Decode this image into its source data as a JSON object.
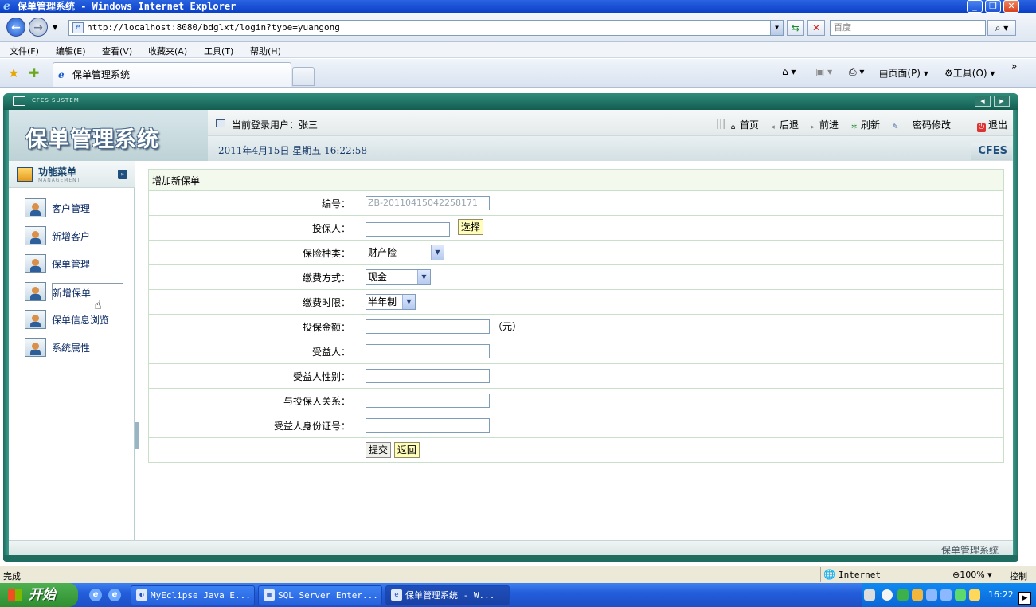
{
  "browser": {
    "window_title": "保单管理系统 - Windows Internet Explorer",
    "url": "http://localhost:8080/bdglxt/login?type=yuangong",
    "search_placeholder": "百度",
    "menu": [
      "文件(F)",
      "编辑(E)",
      "查看(V)",
      "收藏夹(A)",
      "工具(T)",
      "帮助(H)"
    ],
    "tab_label": "保单管理系统",
    "toolbar": {
      "page": "页面(P)",
      "tools": "工具(O)"
    },
    "status_text": "完成",
    "zone": "Internet",
    "zoom": "100%"
  },
  "app": {
    "frame_label": "CFES SUSTEM",
    "system_title": "保单管理系统",
    "current_user": "当前登录用户：张三",
    "datetime": "2011年4月15日  星期五  16:22:58",
    "brand": "CFES",
    "nav": {
      "home": "首页",
      "back": "后退",
      "forward": "前进",
      "refresh": "刷新",
      "change_password": "密码修改",
      "logout": "退出"
    },
    "sidebar": {
      "title": "功能菜单",
      "subtitle": "MANAGEMENT",
      "items": [
        "客户管理",
        "新增客户",
        "保单管理",
        "新增保单",
        "保单信息浏览",
        "系统属性"
      ],
      "active_index": 3
    },
    "form": {
      "caption": "增加新保单",
      "fields": {
        "number_label": "编号：",
        "number_value": "ZB-20110415042258171",
        "insured_label": "投保人：",
        "choose_btn": "选择",
        "type_label": "保险种类：",
        "type_value": "财产险",
        "payment_label": "缴费方式：",
        "payment_value": "现金",
        "period_label": "缴费时限：",
        "period_value": "半年制",
        "amount_label": "投保金额：",
        "amount_unit": "（元）",
        "beneficiary_label": "受益人：",
        "gender_label": "受益人性别：",
        "relation_label": "与投保人关系：",
        "id_label": "受益人身份证号："
      },
      "submit": "提交",
      "back": "返回"
    },
    "footer": "保单管理系统"
  },
  "taskbar": {
    "start": "开始",
    "tasks": [
      "MyEclipse Java E...",
      "SQL Server Enter...",
      "保单管理系统 - W..."
    ],
    "clock": "16:22",
    "side_text": "控制"
  }
}
